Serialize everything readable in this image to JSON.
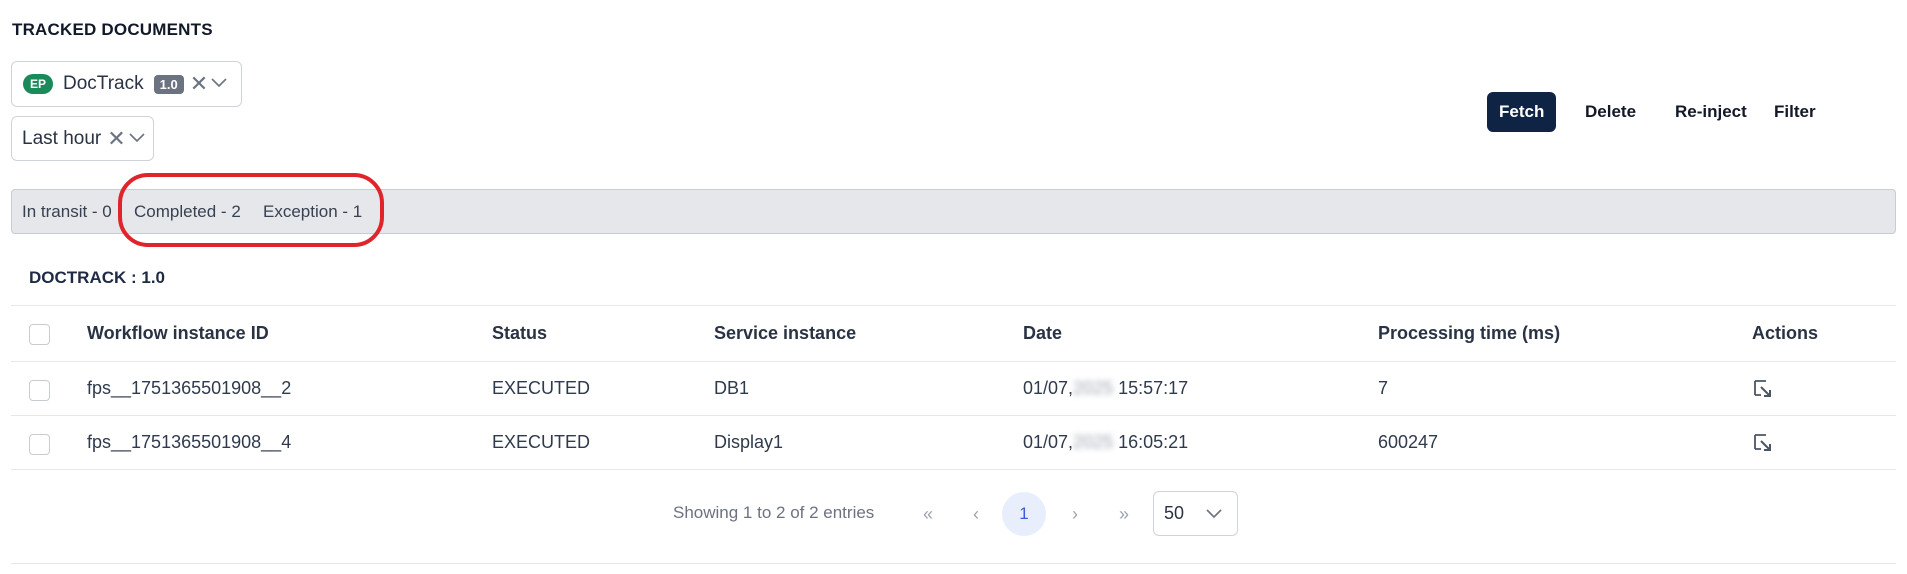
{
  "page_title": "TRACKED DOCUMENTS",
  "doc_filter": {
    "badge": "EP",
    "label": "DocTrack",
    "version": "1.0",
    "clear_icon": "close-icon",
    "dropdown_icon": "chevron-down-icon"
  },
  "time_filter": {
    "label": "Last hour",
    "clear_icon": "close-icon",
    "dropdown_icon": "chevron-down-icon"
  },
  "toolbar": {
    "fetch": "Fetch",
    "delete": "Delete",
    "reinject": "Re-inject",
    "filter": "Filter"
  },
  "status_counts": {
    "in_transit": "In transit - 0",
    "completed": "Completed - 2",
    "exception": "Exception - 1"
  },
  "section_title": "DOCTRACK : 1.0",
  "table": {
    "headers": [
      "Workflow instance ID",
      "Status",
      "Service instance",
      "Date",
      "Processing time (ms)",
      "Actions"
    ],
    "rows": [
      {
        "id": "fps__1751365501908__2",
        "status": "EXECUTED",
        "service": "DB1",
        "date_prefix": "01/07,",
        "date_year": "2025",
        "time": "15:57:17",
        "processing_ms": "7",
        "action_icon": "open-details-icon"
      },
      {
        "id": "fps__1751365501908__4",
        "status": "EXECUTED",
        "service": "Display1",
        "date_prefix": "01/07,",
        "date_year": "2025",
        "time": "16:05:21",
        "processing_ms": "600247",
        "action_icon": "open-details-icon"
      }
    ]
  },
  "pagination": {
    "summary": "Showing 1 to 2 of 2 entries",
    "first": "«",
    "prev": "‹",
    "current": "1",
    "next": "›",
    "last": "»",
    "page_size": "50"
  },
  "colors": {
    "primary": "#0f2444",
    "ep_badge": "#1b8a5a",
    "highlight_ring": "#e0242b"
  }
}
